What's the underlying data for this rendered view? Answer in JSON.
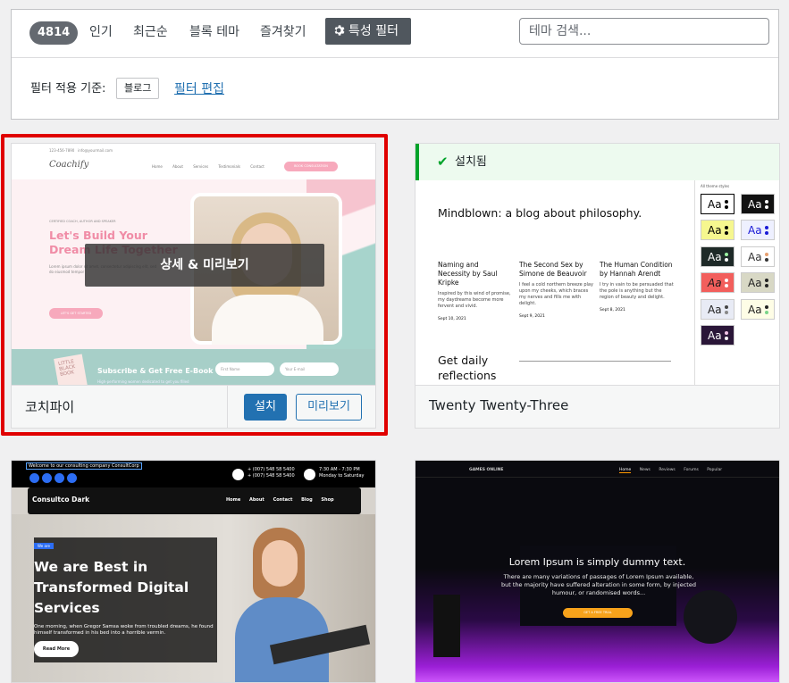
{
  "filter": {
    "count": "4814",
    "tabs": [
      "인기",
      "최근순",
      "블록 테마",
      "즐겨찾기"
    ],
    "feature_filter": "특성 필터",
    "search_placeholder": "테마 검색...",
    "applied_label": "필터 적용 기준:",
    "applied_tag": "블로그",
    "edit_link": "필터 편집"
  },
  "card1": {
    "name": "코치파이",
    "overlay": "상세 & 미리보기",
    "install": "설치",
    "preview": "미리보기",
    "shot": {
      "phone": "123-456-7890",
      "email": "info@yourmail.com",
      "logo": "Coachify",
      "nav": [
        "Home",
        "About",
        "Services",
        "Testimonials",
        "Contact"
      ],
      "nav_btn": "BOOK CONSULTATION",
      "kicker": "CERTIFIED COACH, AUTHOR AND SPEAKER",
      "headline": "Let's Build Your Dream Life Together",
      "body": "Lorem ipsum dolor sit amet, consectetur adipiscing elit, sed do eiusmod tempor",
      "cta": "LET'S GET STARTED",
      "book": "LITTLE BLACK BOOK",
      "subscribe": "Subscribe & Get Free E-Book",
      "sub_small": "High-performing women dedicated to get you filled",
      "field1": "First Name",
      "field2": "Your E-mail"
    }
  },
  "card2": {
    "name": "Twenty Twenty-Three",
    "installed": "설치됨",
    "shot": {
      "title": "Mindblown: a blog about philosophy.",
      "posts": [
        {
          "title": "Naming and Necessity by Saul Kripke",
          "excerpt": "Inspired by this wind of promise, my daydreams become more fervent and vivid.",
          "date": "Sept 10, 2021"
        },
        {
          "title": "The Second Sex by Simone de Beauvoir",
          "excerpt": "I feel a cold northern breeze play upon my cheeks, which braces my nerves and fills me with delight.",
          "date": "Sept 9, 2021"
        },
        {
          "title": "The Human Condition by Hannah Arendt",
          "excerpt": "I try in vain to be persuaded that the pole is anything but the region of beauty and delight.",
          "date": "Sept 8, 2021"
        }
      ],
      "daily": "Get daily reflections",
      "styles_label": "All theme styles",
      "swatch_text": "Aa"
    }
  },
  "card3": {
    "shot": {
      "welcome": "Welcome to our consulting company ConsultCorp",
      "phone1": "+ (007) 548 58 5400",
      "phone2": "+ (007) 548 58 5400",
      "time1": "7:30 AM - 7:30 PM",
      "time2": "Monday to Saturday",
      "logo": "Consultco Dark",
      "nav": [
        "Home",
        "About",
        "Contact",
        "Blog",
        "Shop"
      ],
      "badge": "We are",
      "headline": "We are Best in Transformed Digital Services",
      "body": "One morning, when Gregor Samsa woke from troubled dreams, he found himself transformed in his bed into a horrible vermin.",
      "btn": "Read More"
    }
  },
  "card4": {
    "shot": {
      "logo": "GAMES ONLINE",
      "nav": [
        "Home",
        "News",
        "Reviews",
        "Forums",
        "Popular"
      ],
      "headline": "Lorem Ipsum is simply dummy text.",
      "body": "There are many variations of passages of Lorem Ipsum available, but the majority have suffered alteration in some form, by injected humour, or randomised words...",
      "btn": "GET A FREE TRIAL"
    }
  },
  "colors": {
    "accent": "#2271b1",
    "installed_green": "#00a32a",
    "highlight_red": "#e00000"
  }
}
